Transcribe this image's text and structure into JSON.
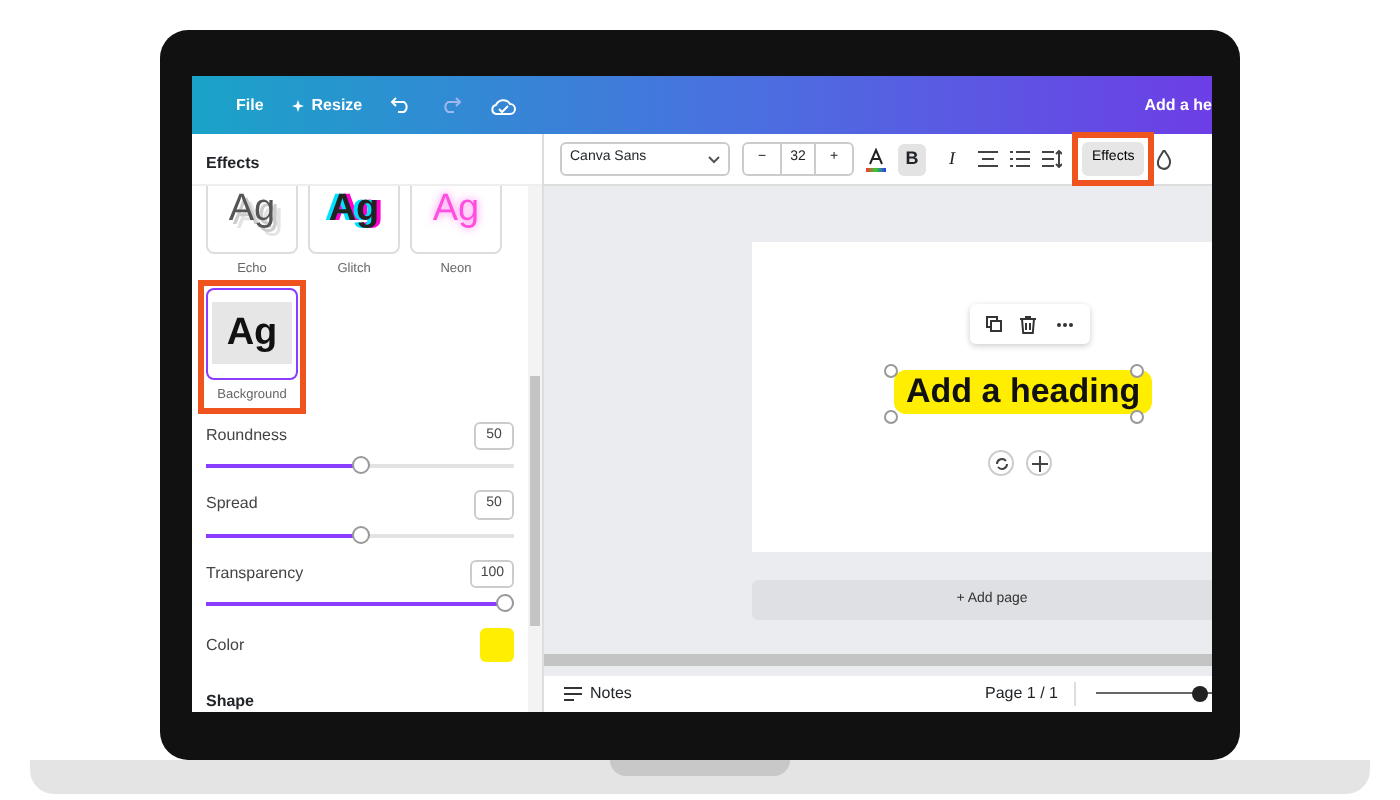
{
  "topbar": {
    "menu": [
      {
        "label": "File"
      },
      {
        "label": "Resize"
      }
    ],
    "title": "Add a he"
  },
  "panel": {
    "title": "Effects",
    "effects": [
      {
        "label": "Echo",
        "preview": "Ag",
        "kind": "echo",
        "selected": false,
        "highlighted": false
      },
      {
        "label": "Glitch",
        "preview": "Ag",
        "kind": "glitch",
        "selected": false,
        "highlighted": false
      },
      {
        "label": "Neon",
        "preview": "Ag",
        "kind": "neon",
        "selected": false,
        "highlighted": false
      },
      {
        "label": "Background",
        "preview": "Ag",
        "kind": "background",
        "selected": true,
        "highlighted": true
      }
    ],
    "sliders": [
      {
        "label": "Roundness",
        "value": "50",
        "level": 0.5
      },
      {
        "label": "Spread",
        "value": "50",
        "level": 0.5
      },
      {
        "label": "Transparency",
        "value": "100",
        "level": 1
      }
    ],
    "color": {
      "label": "Color",
      "color": "#ffee00"
    },
    "shape": {
      "title": "Shape"
    }
  },
  "toolbar": {
    "font": "Canva Sans",
    "size": "32",
    "minus": "−",
    "plus": "+",
    "bold": "B",
    "bold_on": true,
    "italic": "I",
    "effects": "Effects",
    "effects_highlighted": true
  },
  "canvas": {
    "heading": "Add a heading",
    "add_page": "+ Add page"
  },
  "footer": {
    "notes": "Notes",
    "page": "Page 1 / 1",
    "zoom": {
      "level": 0.95
    }
  }
}
